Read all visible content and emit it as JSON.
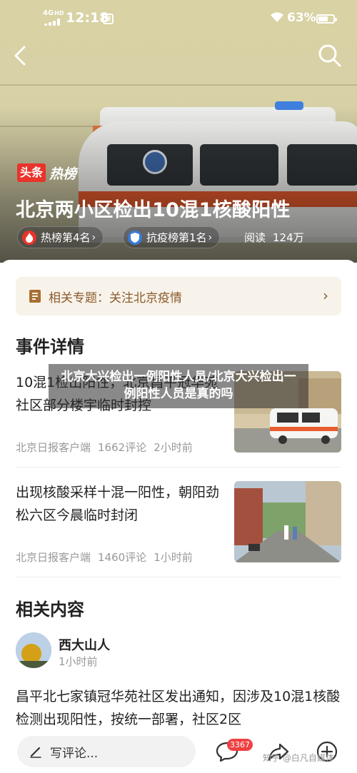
{
  "status_bar": {
    "network": "4G",
    "network_hd": "HD",
    "time": "12:18",
    "app_badge": "浙",
    "battery": "63%"
  },
  "hero": {
    "badge": "头条",
    "badge_suffix": "热榜",
    "title": "北京两小区检出10混1核酸阳性",
    "pills": [
      {
        "icon": "fire-icon",
        "label": "热榜第4名"
      },
      {
        "icon": "shield-icon",
        "label": "抗疫榜第1名"
      }
    ],
    "reads_label": "阅读",
    "reads_value": "124万"
  },
  "topic": {
    "label": "相关专题：",
    "value": "关注北京疫情"
  },
  "events": {
    "heading": "事件详情",
    "items": [
      {
        "title": "10混1检出阳性，北京昌平冠华苑社区部分楼宇临时封控",
        "source": "北京日报客户端",
        "comments": "1662评论",
        "time": "2小时前"
      },
      {
        "title": "出现核酸采样十混一阳性，朝阳劲松六区今晨临时封闭",
        "source": "北京日报客户端",
        "comments": "1460评论",
        "time": "1小时前"
      }
    ]
  },
  "related": {
    "heading": "相关内容",
    "author": "西大山人",
    "ago": "1小时前",
    "body": "昌平北七家镇冠华苑社区发出通知，因涉及10混1核酸检测出现阳性，按统一部署，社区2区"
  },
  "caption": "北京大兴检出一例阳性人员/北京大兴检出一例阳性人员是真的吗",
  "bottom_bar": {
    "comment_placeholder": "写评论...",
    "comment_count": "3367",
    "watermark": "知乎 @白凡自媒体"
  },
  "colors": {
    "brand_red": "#e8342b",
    "topic_bg": "#f8f3ea",
    "topic_text": "#8a5a2b",
    "badge_red": "#f04142"
  }
}
